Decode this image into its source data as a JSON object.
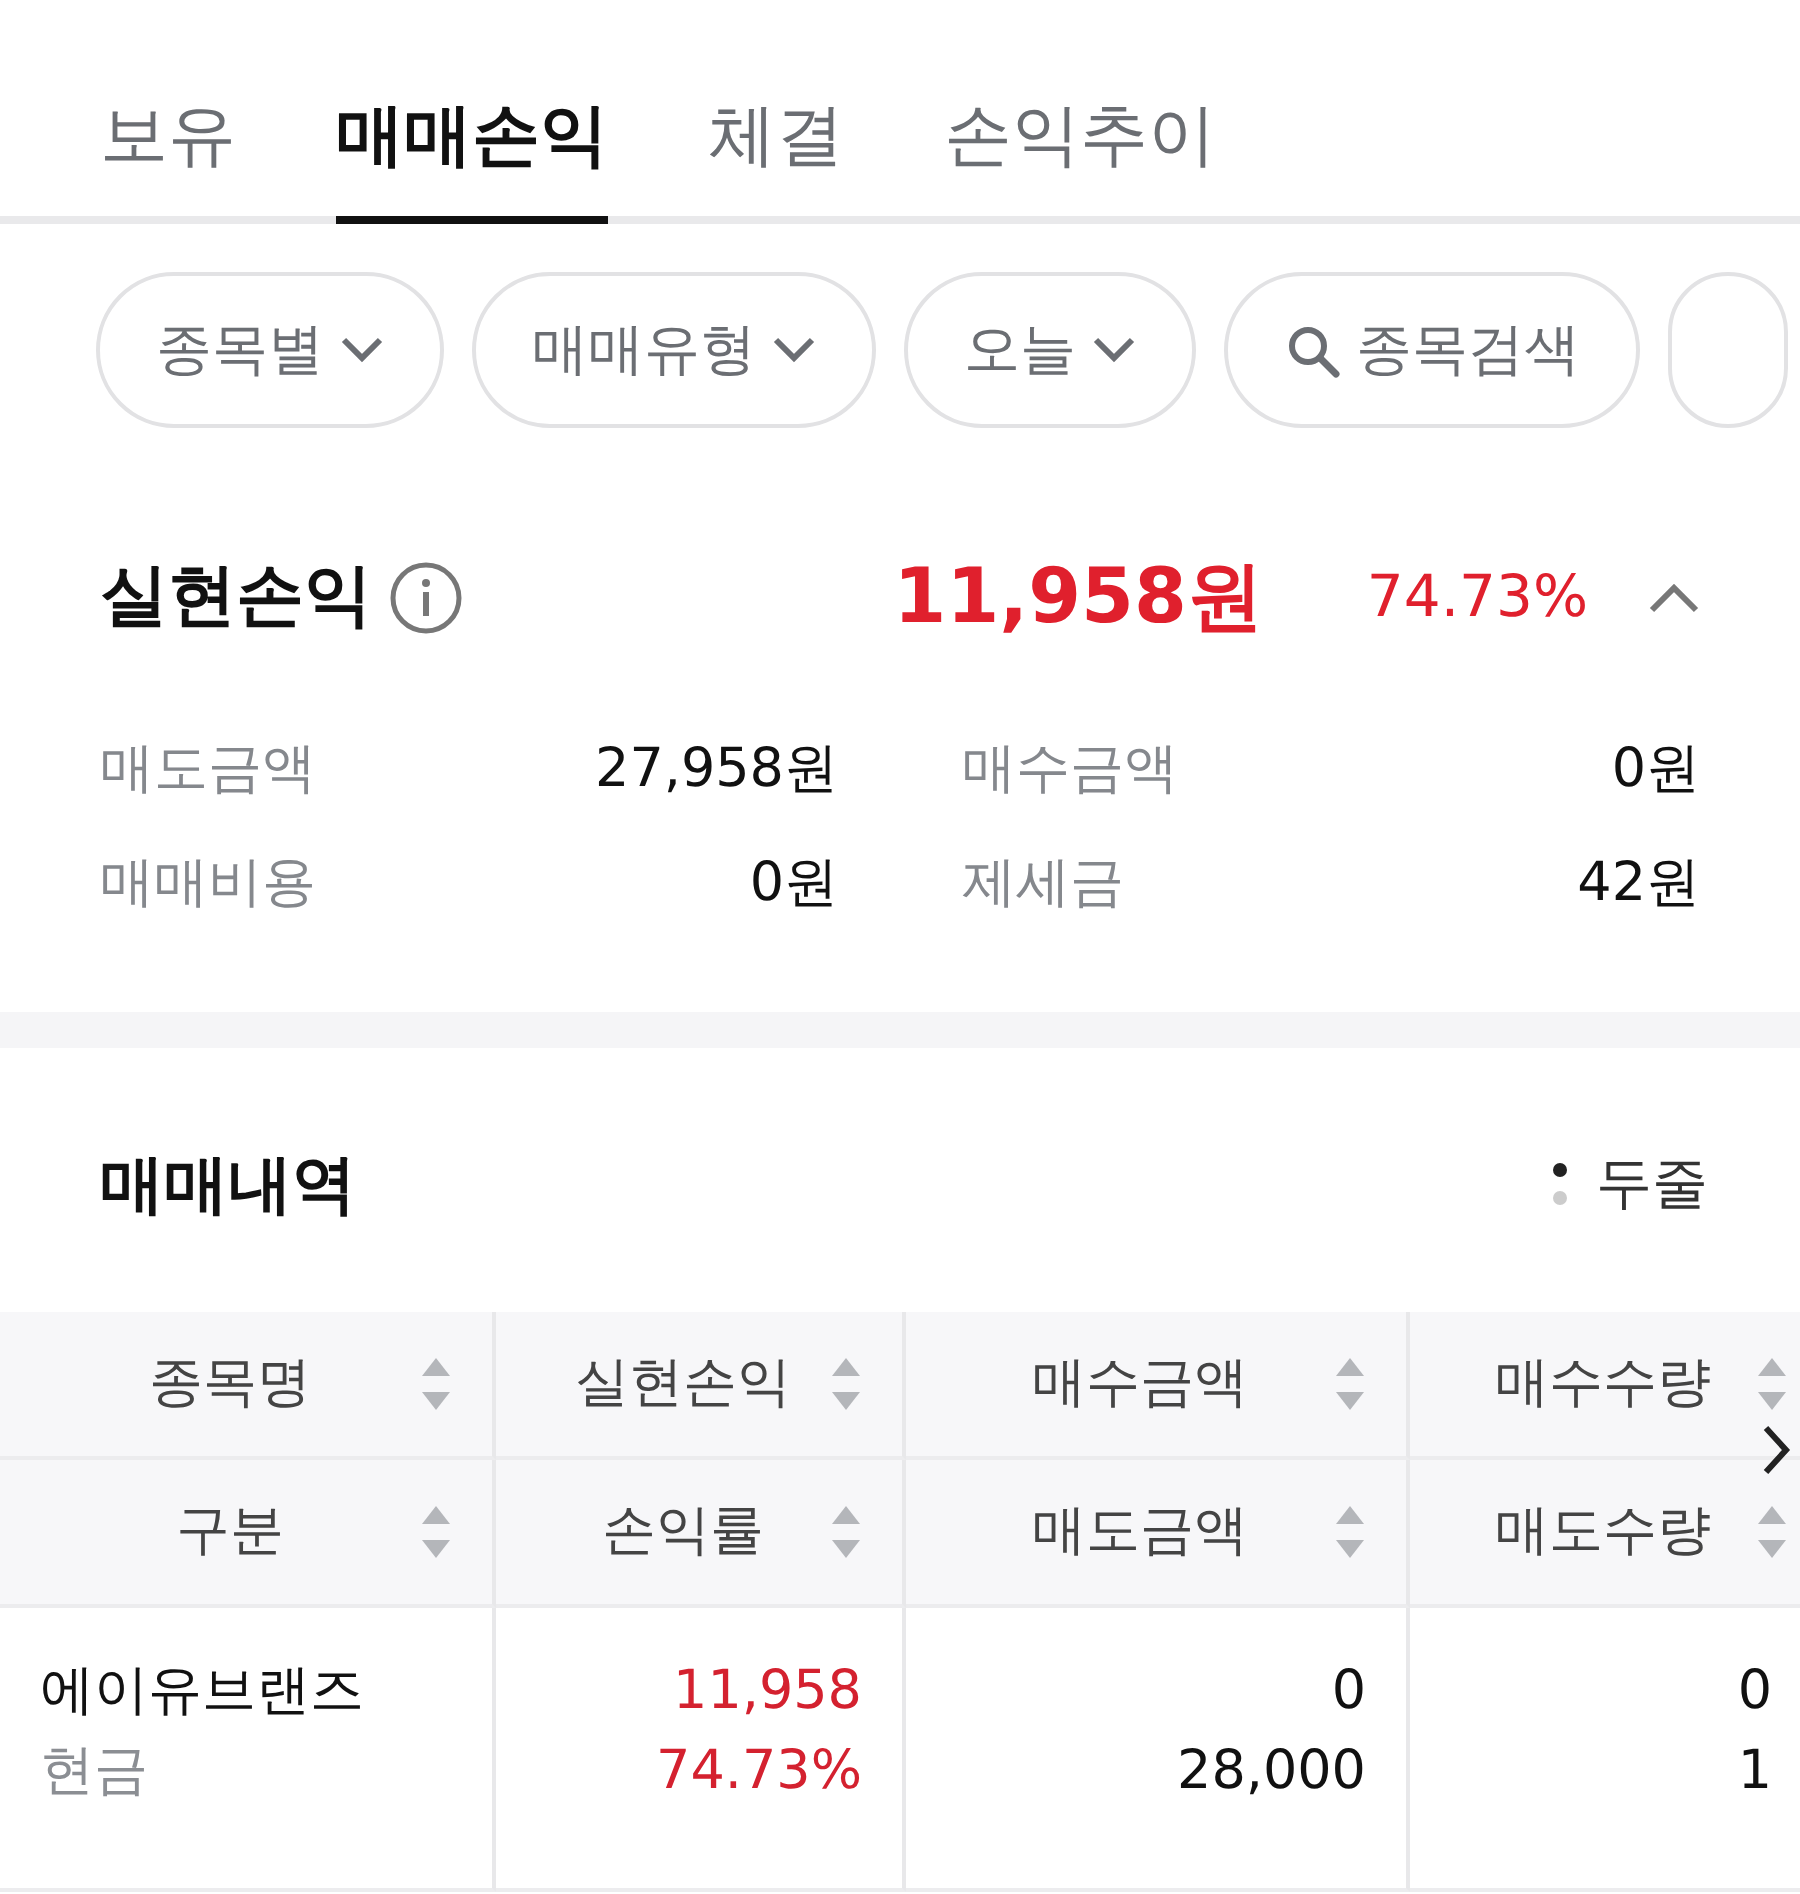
{
  "tabs": [
    {
      "label": "보유",
      "selected": false
    },
    {
      "label": "매매손익",
      "selected": true
    },
    {
      "label": "체결",
      "selected": false
    },
    {
      "label": "손익추이",
      "selected": false
    }
  ],
  "filters": [
    {
      "kind": "dropdown",
      "label": "종목별"
    },
    {
      "kind": "dropdown",
      "label": "매매유형"
    },
    {
      "kind": "dropdown",
      "label": "오늘"
    },
    {
      "kind": "search",
      "label": "종목검색"
    },
    {
      "kind": "empty"
    }
  ],
  "summary": {
    "title": "실현손익",
    "amount": "11,958원",
    "rate": "74.73%",
    "expanded": true,
    "details": [
      {
        "label": "매도금액",
        "value": "27,958원"
      },
      {
        "label": "매수금액",
        "value": "0원"
      },
      {
        "label": "매매비용",
        "value": "0원"
      },
      {
        "label": "제세금",
        "value": "42원"
      }
    ]
  },
  "trades": {
    "title": "매매내역",
    "view_toggle": "두줄",
    "header_rows": [
      [
        "종목명",
        "실현손익",
        "매수금액",
        "매수수량"
      ],
      [
        "구분",
        "손익률",
        "매도금액",
        "매도수량"
      ]
    ],
    "rows": [
      {
        "cells": [
          [
            "에이유브랜즈",
            "현금"
          ],
          [
            "11,958",
            "74.73%"
          ],
          [
            "0",
            "28,000"
          ],
          [
            "0",
            "1"
          ]
        ]
      }
    ]
  }
}
